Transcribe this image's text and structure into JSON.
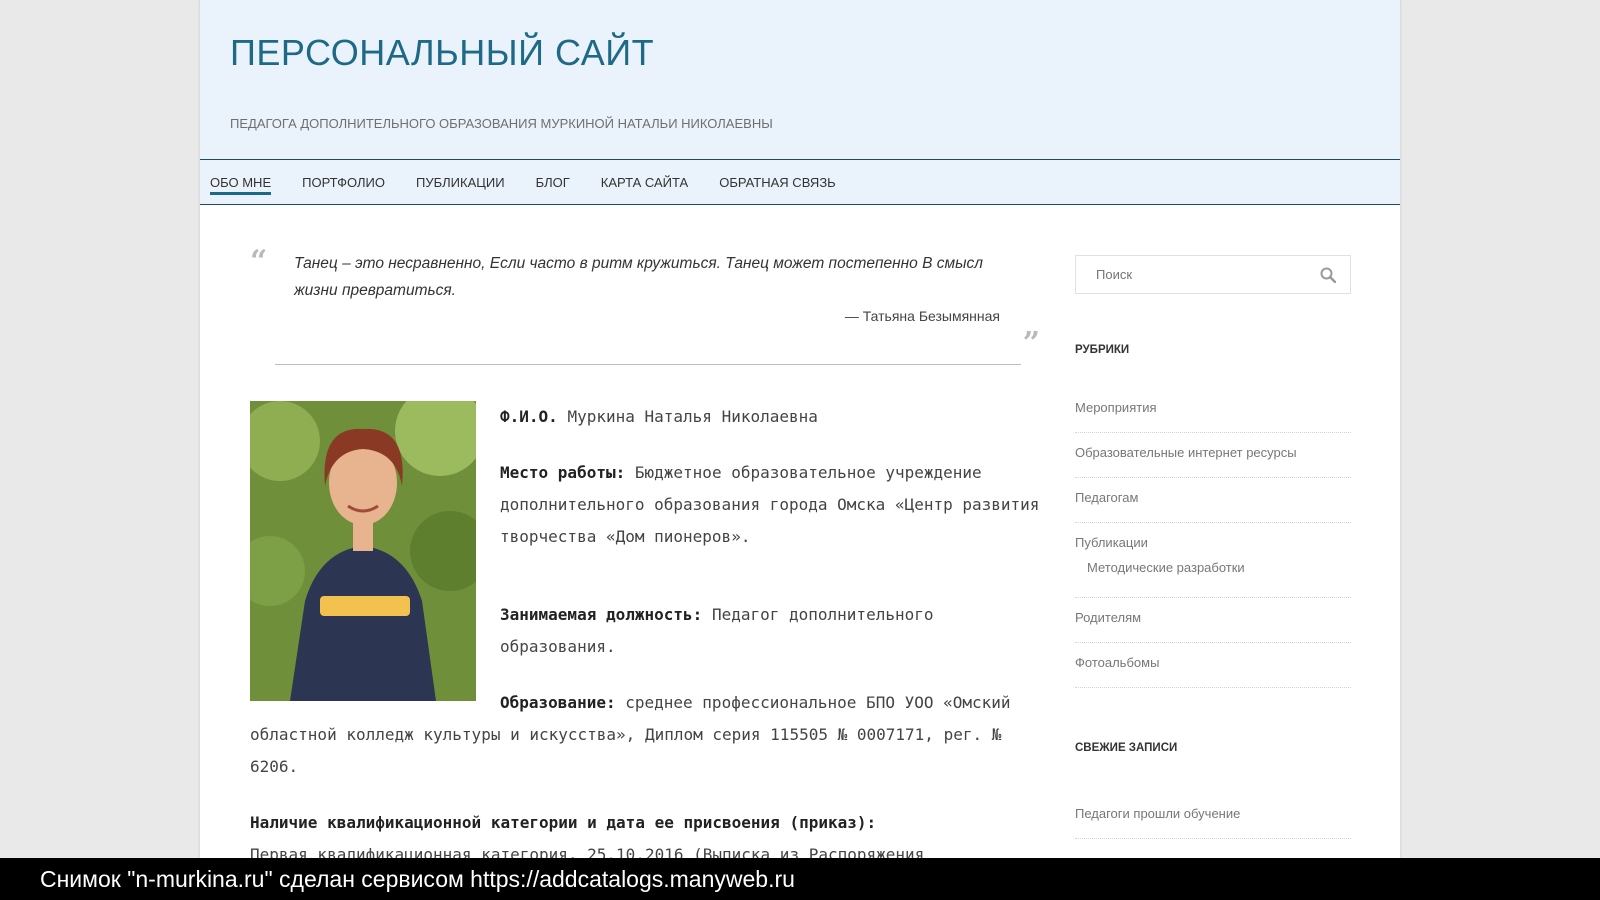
{
  "header": {
    "site_title": "ПЕРСОНАЛЬНЫЙ САЙТ",
    "site_description": "ПЕДАГОГА ДОПОЛНИТЕЛЬНОГО ОБРАЗОВАНИЯ МУРКИНОЙ НАТАЛЬИ НИКОЛАЕВНЫ"
  },
  "nav": {
    "items": [
      {
        "label": "ОБО МНЕ",
        "active": true
      },
      {
        "label": "ПОРТФОЛИО"
      },
      {
        "label": "ПУБЛИКАЦИИ"
      },
      {
        "label": "БЛОГ"
      },
      {
        "label": "КАРТА САЙТА"
      },
      {
        "label": "ОБРАТНАЯ СВЯЗЬ"
      }
    ]
  },
  "quote": {
    "text": "Танец – это несравненно, Если часто в ритм кружиться. Танец может постепенно В смысл жизни превратиться.",
    "author": "— Татьяна Безымянная"
  },
  "bio": {
    "fio_label": "Ф.И.О.",
    "fio_value": "Муркина Наталья Николаевна",
    "work_label": "Место работы:",
    "work_value": "Бюджетное образовательное учреждение дополнительного образования города Омска «Центр развития творчества «Дом пионеров».",
    "position_label": "Занимаемая должность:",
    "position_value": "Педагог дополнительного образования.",
    "education_label": "Образование:",
    "education_value": "среднее профессиональное БПО УОО «Омский областной колледж культуры и искусства», Диплом серия 115505 № 0007171, рег. № 6206.",
    "category_label": "Наличие квалификационной категории и дата ее присвоения (приказ):",
    "category_value": "Первая квалификационная категория, 25.10.2016 (Выписка из Распоряжения"
  },
  "sidebar": {
    "search_placeholder": "Поиск",
    "categories_title": "РУБРИКИ",
    "categories": [
      "Мероприятия",
      "Образовательные интернет ресурсы",
      "Педагогам",
      "Публикации",
      "Методические разработки",
      "Родителям",
      "Фотоальбомы"
    ],
    "recent_title": "СВЕЖИЕ ЗАПИСИ",
    "recent": [
      "Педагоги прошли обучение"
    ]
  },
  "watermark": "Снимок \"n-murkina.ru\" сделан сервисом https://addcatalogs.manyweb.ru",
  "colors": {
    "accent": "#1e6a86",
    "header_bg": "#eaf3fb"
  }
}
